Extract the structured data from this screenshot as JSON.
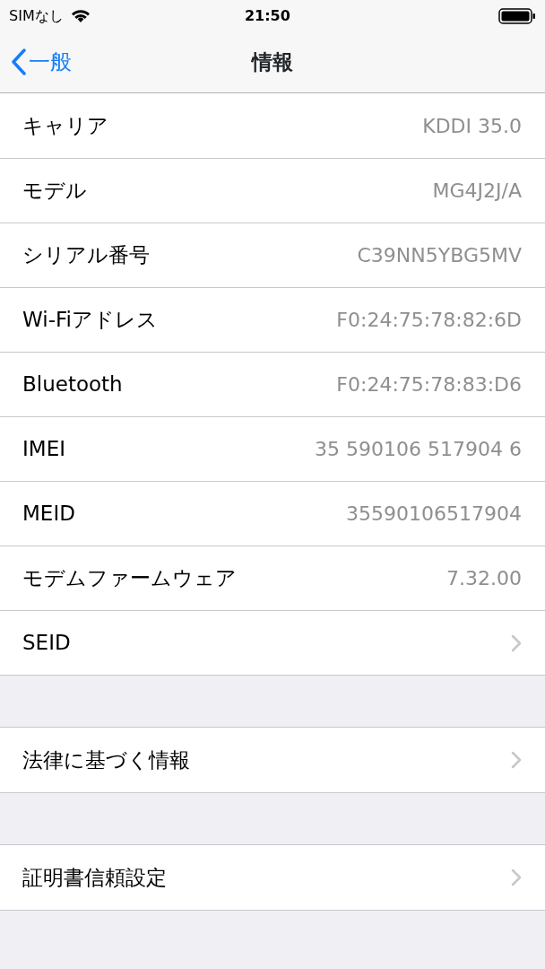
{
  "status_bar": {
    "carrier": "SIMなし",
    "time": "21:50"
  },
  "nav_bar": {
    "back_label": "一般",
    "title": "情報"
  },
  "sections": [
    {
      "rows": [
        {
          "label": "キャリア",
          "value": "KDDI 35.0",
          "kind": "value"
        },
        {
          "label": "モデル",
          "value": "MG4J2J/A",
          "kind": "value"
        },
        {
          "label": "シリアル番号",
          "value": "C39NN5YBG5MV",
          "kind": "value"
        },
        {
          "label": "Wi-Fiアドレス",
          "value": "F0:24:75:78:82:6D",
          "kind": "value"
        },
        {
          "label": "Bluetooth",
          "value": "F0:24:75:78:83:D6",
          "kind": "value"
        },
        {
          "label": "IMEI",
          "value": "35 590106 517904 6",
          "kind": "value"
        },
        {
          "label": "MEID",
          "value": "35590106517904",
          "kind": "value"
        },
        {
          "label": "モデムファームウェア",
          "value": "7.32.00",
          "kind": "value"
        },
        {
          "label": "SEID",
          "kind": "disclosure"
        }
      ]
    },
    {
      "rows": [
        {
          "label": "法律に基づく情報",
          "kind": "disclosure"
        }
      ]
    },
    {
      "rows": [
        {
          "label": "証明書信頼設定",
          "kind": "disclosure"
        }
      ]
    }
  ]
}
